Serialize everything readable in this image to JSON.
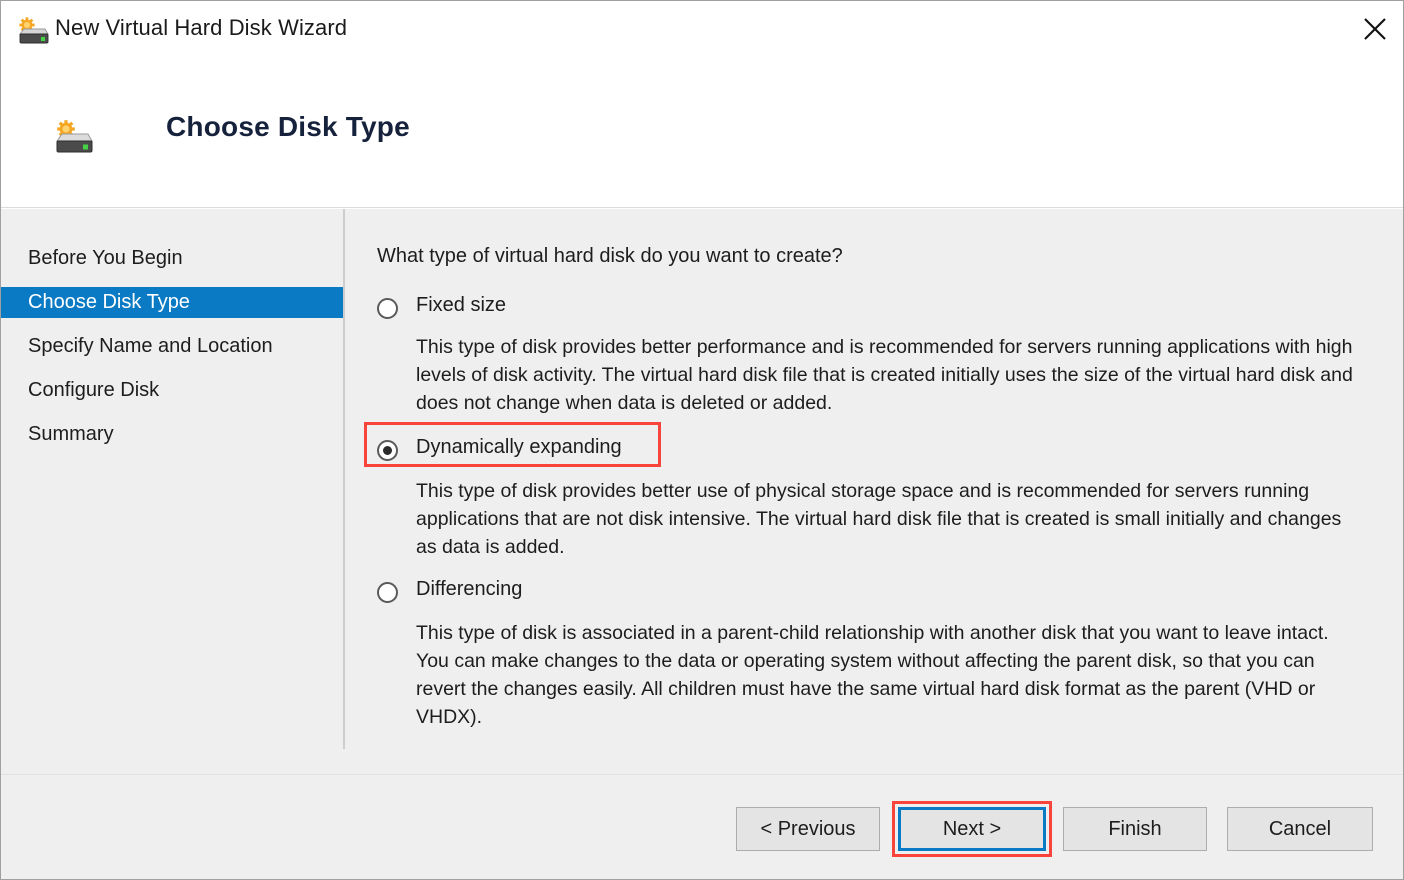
{
  "window": {
    "title": "New Virtual Hard Disk Wizard",
    "title_icon": "hard-disk-new-icon",
    "close_icon": "close-icon",
    "accent_color": "#0b7ac4",
    "highlight_color": "#f9443c"
  },
  "header": {
    "icon": "hard-disk-new-icon",
    "title": "Choose Disk Type"
  },
  "sidebar": {
    "items": [
      {
        "label": "Before You Begin",
        "active": false
      },
      {
        "label": "Choose Disk Type",
        "active": true
      },
      {
        "label": "Specify Name and Location",
        "active": false
      },
      {
        "label": "Configure Disk",
        "active": false
      },
      {
        "label": "Summary",
        "active": false
      }
    ]
  },
  "main": {
    "question": "What type of virtual hard disk do you want to create?",
    "options": [
      {
        "label": "Fixed size",
        "selected": false,
        "description": "This type of disk provides better performance and is recommended for servers running applications with high levels of disk activity. The virtual hard disk file that is created initially uses the size of the virtual hard disk and does not change when data is deleted or added."
      },
      {
        "label": "Dynamically expanding",
        "selected": true,
        "description": "This type of disk provides better use of physical storage space and is recommended for servers running applications that are not disk intensive. The virtual hard disk file that is created is small initially and changes as data is added."
      },
      {
        "label": "Differencing",
        "selected": false,
        "description": "This type of disk is associated in a parent-child relationship with another disk that you want to leave intact. You can make changes to the data or operating system without affecting the parent disk, so that you can revert the changes easily. All children must have the same virtual hard disk format as the parent (VHD or VHDX)."
      }
    ]
  },
  "footer": {
    "previous_label": "< Previous",
    "next_label": "Next >",
    "finish_label": "Finish",
    "cancel_label": "Cancel"
  }
}
